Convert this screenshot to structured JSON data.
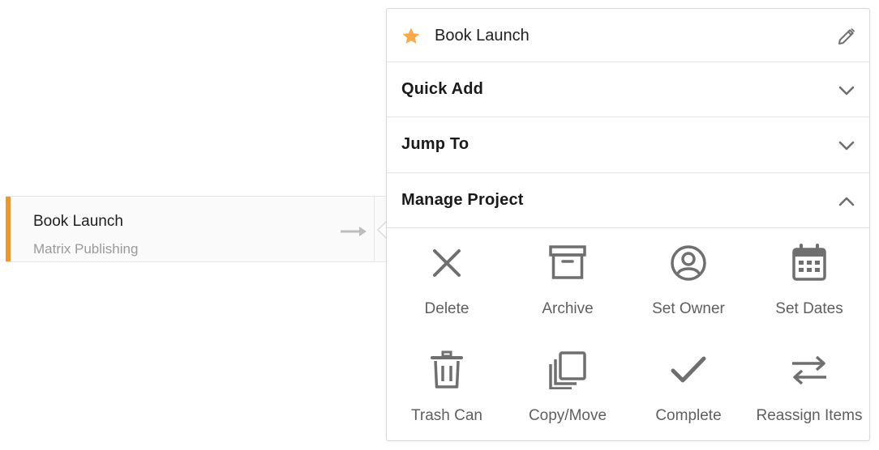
{
  "project_card": {
    "name": "Book Launch",
    "client": "Matrix Publishing",
    "accent_color": "#f0962a",
    "arrow_icon": "arrow-right-icon"
  },
  "panel": {
    "header": {
      "star_icon": "star-icon",
      "star_color": "#f8a94a",
      "title": "Book Launch",
      "edit_icon": "pencil-icon"
    },
    "sections": [
      {
        "title": "Quick Add",
        "expanded": false,
        "chevron": "chevron-down-icon"
      },
      {
        "title": "Jump To",
        "expanded": false,
        "chevron": "chevron-down-icon"
      },
      {
        "title": "Manage Project",
        "expanded": true,
        "chevron": "chevron-up-icon"
      }
    ],
    "actions": [
      {
        "label": "Delete",
        "icon": "close-icon"
      },
      {
        "label": "Archive",
        "icon": "archive-box-icon"
      },
      {
        "label": "Set Owner",
        "icon": "user-circle-icon"
      },
      {
        "label": "Set Dates",
        "icon": "calendar-icon"
      },
      {
        "label": "Trash Can",
        "icon": "trash-icon"
      },
      {
        "label": "Copy/Move",
        "icon": "copy-icon"
      },
      {
        "label": "Complete",
        "icon": "checkmark-icon"
      },
      {
        "label": "Reassign Items",
        "icon": "swap-arrows-icon"
      }
    ],
    "icon_color": "#6f6f6f"
  }
}
